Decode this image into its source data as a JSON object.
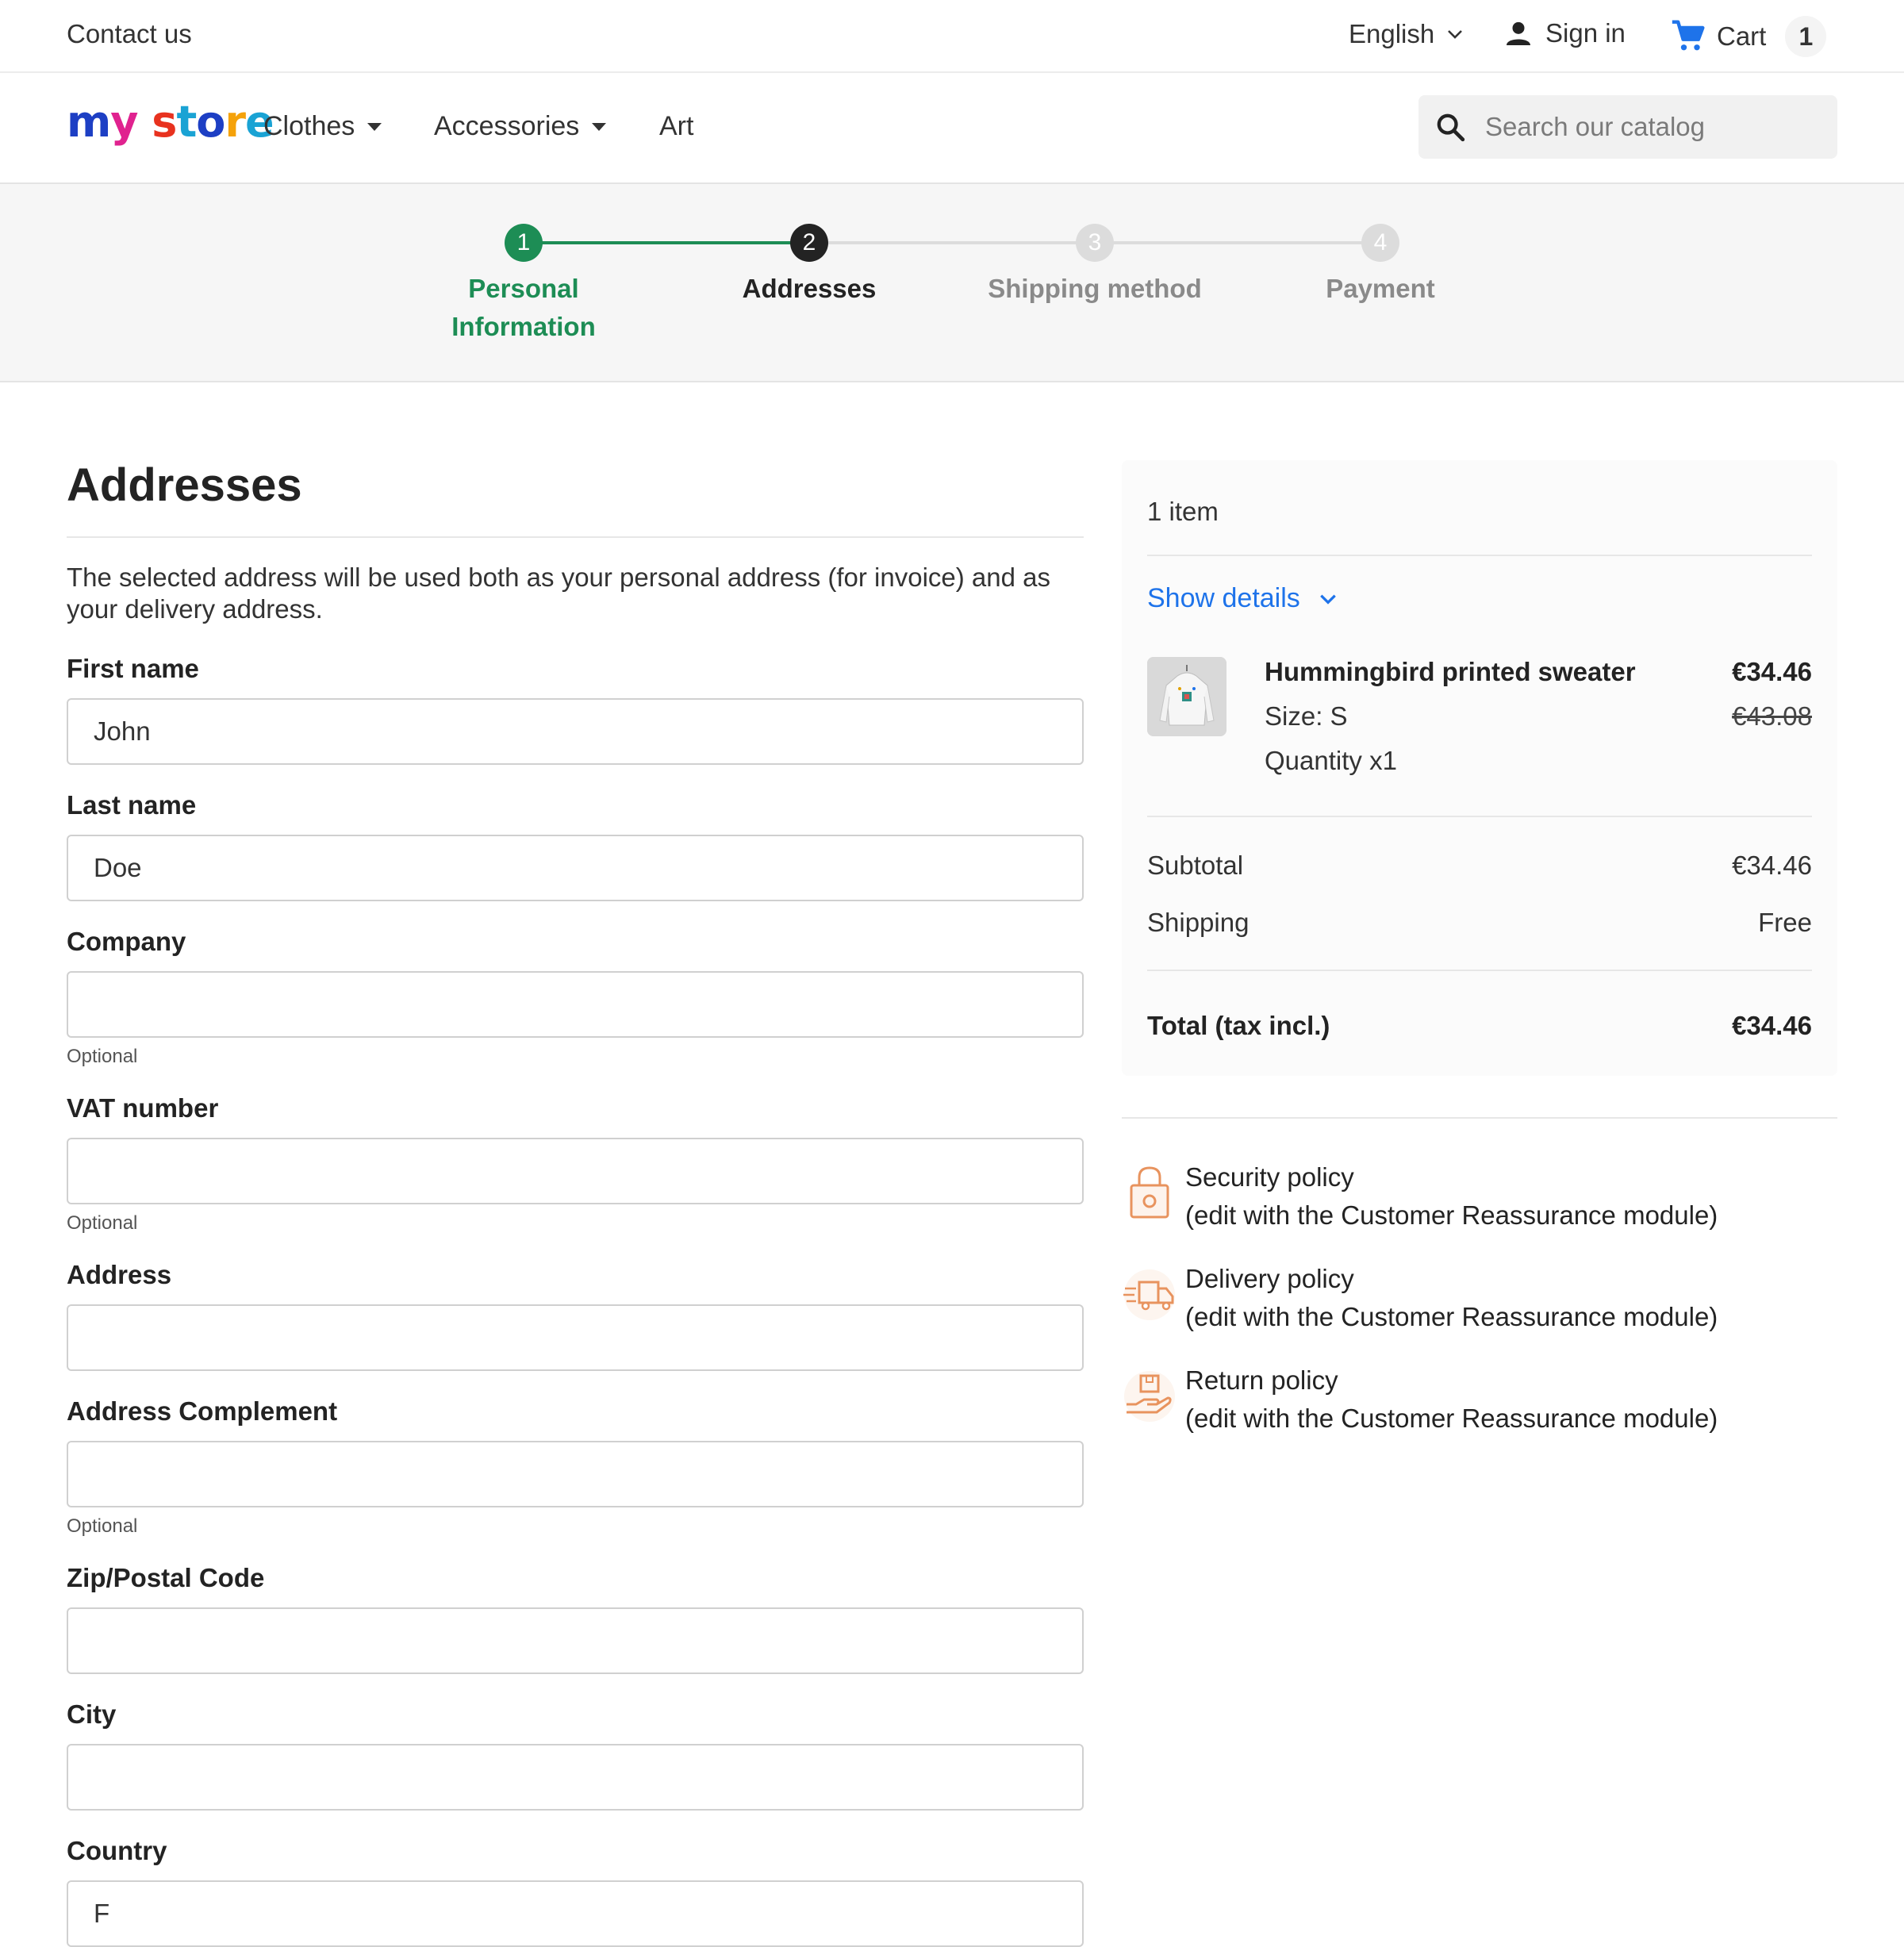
{
  "topbar": {
    "contact": "Contact us",
    "language": "English",
    "sign_in": "Sign in",
    "cart_label": "Cart",
    "cart_count": "1"
  },
  "header": {
    "logo": {
      "part1": "my",
      "part2": "store"
    },
    "nav": [
      "Clothes",
      "Accessories",
      "Art"
    ],
    "search_placeholder": "Search our catalog"
  },
  "steps": [
    {
      "number": "1",
      "label": "Personal Information",
      "state": "done"
    },
    {
      "number": "2",
      "label": "Addresses",
      "state": "current"
    },
    {
      "number": "3",
      "label": "Shipping method",
      "state": "upcoming"
    },
    {
      "number": "4",
      "label": "Payment",
      "state": "upcoming"
    }
  ],
  "colors": {
    "done": "#1d8d55",
    "current": "#232323",
    "upcoming": "#dcdcdc",
    "link": "#1e73ea",
    "reassurance": "#e8935e"
  },
  "form": {
    "title": "Addresses",
    "intro": "The selected address will be used both as your personal address (for invoice) and as your delivery address.",
    "fields": {
      "first_name": {
        "label": "First name",
        "value": "John"
      },
      "last_name": {
        "label": "Last name",
        "value": "Doe"
      },
      "company": {
        "label": "Company",
        "value": "",
        "help": "Optional"
      },
      "vat": {
        "label": "VAT number",
        "value": "",
        "help": "Optional"
      },
      "address": {
        "label": "Address",
        "value": ""
      },
      "address2": {
        "label": "Address Complement",
        "value": "",
        "help": "Optional"
      },
      "postcode": {
        "label": "Zip/Postal Code",
        "value": ""
      },
      "city": {
        "label": "City",
        "value": ""
      },
      "country": {
        "label": "Country",
        "value": "F"
      }
    }
  },
  "summary": {
    "items_count": "1 item",
    "show_details": "Show details",
    "product": {
      "name": "Hummingbird printed sweater",
      "size": "Size: S",
      "quantity": "Quantity x1",
      "price": "€34.46",
      "old_price": "€43.08"
    },
    "subtotal_label": "Subtotal",
    "subtotal_value": "€34.46",
    "shipping_label": "Shipping",
    "shipping_value": "Free",
    "total_label": "Total (tax incl.)",
    "total_value": "€34.46"
  },
  "reassurance": [
    {
      "icon": "lock-icon",
      "title": "Security policy",
      "text": "(edit with the Customer Reassurance module)"
    },
    {
      "icon": "delivery-truck-icon",
      "title": "Delivery policy",
      "text": "(edit with the Customer Reassurance module)"
    },
    {
      "icon": "return-box-icon",
      "title": "Return policy",
      "text": "(edit with the Customer Reassurance module)"
    }
  ]
}
